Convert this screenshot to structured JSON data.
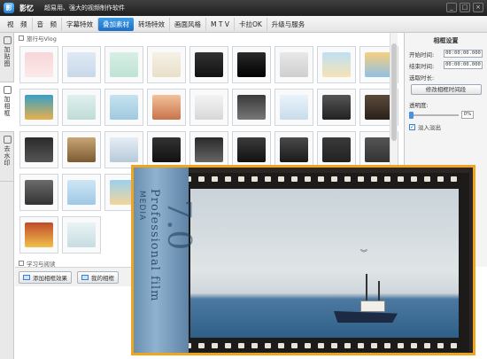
{
  "app": {
    "logo_letter": "影",
    "name": "影忆",
    "slogan": "超易用、强大的视频制作软件",
    "window_controls": [
      "_",
      "□",
      "×"
    ]
  },
  "menu": [
    {
      "label": "视　频",
      "active": false
    },
    {
      "label": "音　频",
      "active": false
    },
    {
      "label": "字幕特效",
      "active": false
    },
    {
      "label": "叠加素材",
      "active": true
    },
    {
      "label": "转场特效",
      "active": false
    },
    {
      "label": "画面风格",
      "active": false
    },
    {
      "label": "M T V",
      "active": false
    },
    {
      "label": "卡拉OK",
      "active": false
    },
    {
      "label": "升级与服务",
      "active": false
    }
  ],
  "side_tabs": [
    {
      "label": "加贴图",
      "icon": "sticker-icon",
      "active": false
    },
    {
      "label": "加相框",
      "icon": "frame-icon",
      "active": true
    },
    {
      "label": "去水印",
      "icon": "watermark-icon",
      "active": false
    }
  ],
  "categories": {
    "first": "旅行与Vlog",
    "second": "学习与阅读"
  },
  "bottom_buttons": {
    "add_frame": "添加相框效果",
    "my_frames": "我的相框"
  },
  "settings": {
    "title": "相框设置",
    "start_label": "开始时间:",
    "start_value": "00:00:00.000",
    "end_label": "结束时间:",
    "end_value": "00:00:00.000",
    "duration_label": "选取时长:",
    "duration_value": "",
    "modify_button": "修改相框时间段",
    "opacity_label": "透明度:",
    "opacity_value": "0%",
    "fade_label": "淡入淡出",
    "fade_checked": true
  },
  "preview": {
    "spine_text_1": "Professional film",
    "spine_text_2": "MEDIA",
    "spine_big": "7.0"
  },
  "colors": {
    "accent_orange": "#f0a51e",
    "menu_active": "#1c6fc7"
  }
}
